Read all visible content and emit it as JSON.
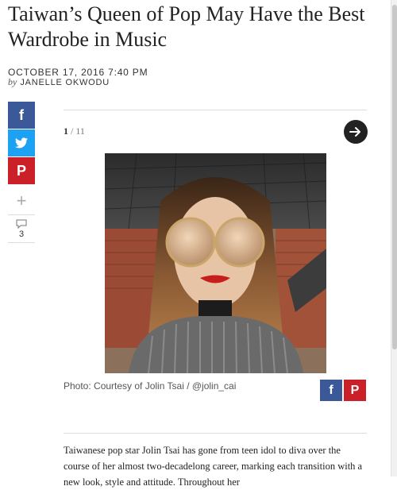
{
  "article": {
    "headline": "Taiwan’s Queen of Pop May Have the Best Wardrobe in Music",
    "date": "OCTOBER 17, 2016 7:40 PM",
    "by": "by",
    "author": "JANELLE OKWODU"
  },
  "share_rail": {
    "facebook": "f",
    "pinterest": "P",
    "plus": "+",
    "comment_count": "3"
  },
  "slideshow": {
    "current": "1",
    "separator": " / ",
    "total": "11",
    "photo_credit": "Photo: Courtesy of Jolin Tsai / @jolin_cai",
    "share_facebook": "f",
    "share_pinterest": "P"
  },
  "body": {
    "paragraph": "Taiwanese pop star Jolin Tsai has gone from teen idol to diva over the course of her almost two-decadelong career, marking each transition with a new look, style and attitude. Throughout her"
  },
  "colors": {
    "facebook": "#3b5998",
    "twitter": "#1da1f2",
    "pinterest": "#cb2027",
    "next_button": "#222222"
  },
  "icons": [
    "facebook-icon",
    "twitter-icon",
    "pinterest-icon",
    "plus-icon",
    "comment-icon",
    "arrow-right-icon"
  ]
}
